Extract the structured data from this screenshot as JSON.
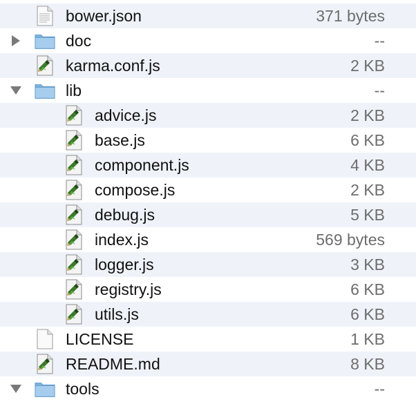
{
  "files": [
    {
      "name": "bower.json",
      "size": "371 bytes",
      "icon": "text-file-icon",
      "depth": 0,
      "folder": false
    },
    {
      "name": "doc",
      "size": "--",
      "icon": "folder-icon",
      "depth": 0,
      "folder": true,
      "expanded": false
    },
    {
      "name": "karma.conf.js",
      "size": "2 KB",
      "icon": "script-file-icon",
      "depth": 0,
      "folder": false
    },
    {
      "name": "lib",
      "size": "--",
      "icon": "folder-icon",
      "depth": 0,
      "folder": true,
      "expanded": true
    },
    {
      "name": "advice.js",
      "size": "2 KB",
      "icon": "script-file-icon",
      "depth": 1,
      "folder": false
    },
    {
      "name": "base.js",
      "size": "6 KB",
      "icon": "script-file-icon",
      "depth": 1,
      "folder": false
    },
    {
      "name": "component.js",
      "size": "4 KB",
      "icon": "script-file-icon",
      "depth": 1,
      "folder": false
    },
    {
      "name": "compose.js",
      "size": "2 KB",
      "icon": "script-file-icon",
      "depth": 1,
      "folder": false
    },
    {
      "name": "debug.js",
      "size": "5 KB",
      "icon": "script-file-icon",
      "depth": 1,
      "folder": false
    },
    {
      "name": "index.js",
      "size": "569 bytes",
      "icon": "script-file-icon",
      "depth": 1,
      "folder": false
    },
    {
      "name": "logger.js",
      "size": "3 KB",
      "icon": "script-file-icon",
      "depth": 1,
      "folder": false
    },
    {
      "name": "registry.js",
      "size": "6 KB",
      "icon": "script-file-icon",
      "depth": 1,
      "folder": false
    },
    {
      "name": "utils.js",
      "size": "6 KB",
      "icon": "script-file-icon",
      "depth": 1,
      "folder": false
    },
    {
      "name": "LICENSE",
      "size": "1 KB",
      "icon": "blank-file-icon",
      "depth": 0,
      "folder": false
    },
    {
      "name": "README.md",
      "size": "8 KB",
      "icon": "script-file-icon",
      "depth": 0,
      "folder": false
    },
    {
      "name": "tools",
      "size": "--",
      "icon": "folder-icon",
      "depth": 0,
      "folder": true,
      "expanded": true
    }
  ],
  "colors": {
    "row_alt": "#eff3f9",
    "folder": "#7cb3e0",
    "name_text": "#111111",
    "size_text": "#6d6d6d"
  }
}
